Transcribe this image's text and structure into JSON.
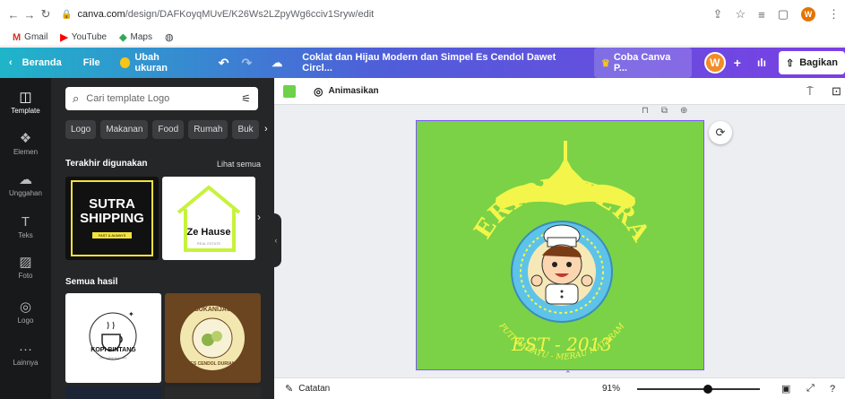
{
  "browser": {
    "url_host": "canva.com",
    "url_path": "/design/DAFKoyqMUvE/K26Ws2LZpyWg6cciv1Sryw/edit",
    "profile_initial": "W",
    "bookmarks": [
      {
        "label": "Gmail",
        "icon": "gmail-icon",
        "icon_glyph": "M",
        "color": "#d93025"
      },
      {
        "label": "YouTube",
        "icon": "youtube-icon",
        "icon_glyph": "▶",
        "color": "#ff0000"
      },
      {
        "label": "Maps",
        "icon": "maps-icon",
        "icon_glyph": "◆",
        "color": "#34a853"
      }
    ]
  },
  "topbar": {
    "back_label": "Beranda",
    "file_label": "File",
    "resize_label": "Ubah ukuran",
    "doc_title": "Coklat dan Hijau Modern dan Simpel Es Cendol Dawet Circl...",
    "try_label": "Coba Canva P...",
    "avatar_initial": "W",
    "share_label": "Bagikan"
  },
  "rail": {
    "items": [
      {
        "label": "Template",
        "icon": "template-icon",
        "glyph": "◫"
      },
      {
        "label": "Elemen",
        "icon": "elements-icon",
        "glyph": "❖"
      },
      {
        "label": "Unggahan",
        "icon": "upload-icon",
        "glyph": "☁"
      },
      {
        "label": "Teks",
        "icon": "text-icon",
        "glyph": "T"
      },
      {
        "label": "Foto",
        "icon": "photo-icon",
        "glyph": "▨"
      },
      {
        "label": "Logo",
        "icon": "logo-icon",
        "glyph": "◎"
      },
      {
        "label": "Lainnya",
        "icon": "more-icon",
        "glyph": "···"
      }
    ]
  },
  "panel": {
    "search_placeholder": "Cari template Logo",
    "chips": [
      "Logo",
      "Makanan",
      "Food",
      "Rumah",
      "Buk"
    ],
    "recent_title": "Terakhir digunakan",
    "see_all": "Lihat semua",
    "all_results_title": "Semua hasil",
    "thumbs": {
      "sutra_line1": "SUTRA",
      "sutra_line2": "SHIPPING",
      "sutra_tag": "FAST & ALWAYS",
      "zehause": "Ze Hause",
      "zehause_sub": "REAL ESTATE",
      "kopi": "KOPI BINTANG",
      "kopi_sub": "Coffee shop & roastery",
      "sukanijau_top": "SUKANIJAU",
      "sukanijau_bottom": "ES CENDOL DURIAN"
    }
  },
  "editor": {
    "animate_label": "Animasikan",
    "notes_label": "Catatan",
    "zoom": "91%",
    "zoom_fraction": 0.58,
    "swatch_color": "#6ed14a"
  },
  "design": {
    "arch_text": "KERIPIKTERAS",
    "est_text": "EST - 2013",
    "bottom_text": "PUTI RAHAYU - MERAU MATARAM",
    "bg_color": "#7bd246",
    "accent": "#f4f54a"
  }
}
